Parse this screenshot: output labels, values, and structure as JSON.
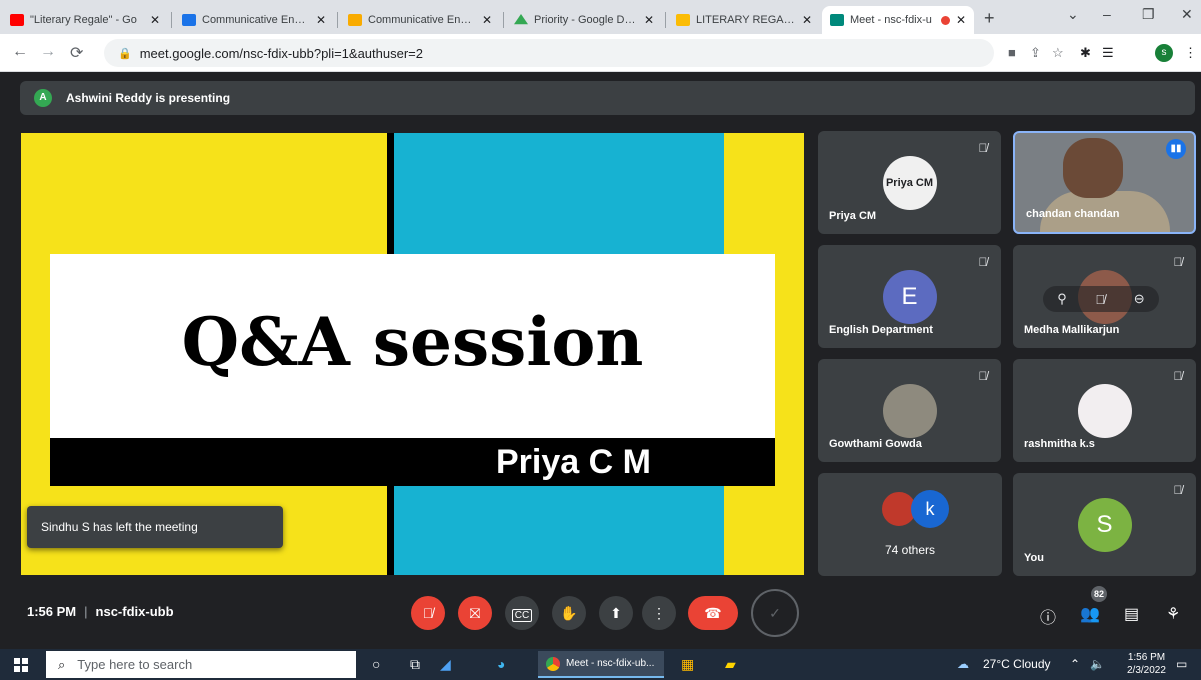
{
  "browser": {
    "tabs": [
      {
        "title": "\"Literary Regale\" - Go",
        "icon_color": "#ff0000",
        "icon": "youtube-icon",
        "active": false
      },
      {
        "title": "Communicative Englis",
        "icon_color": "#1a73e8",
        "icon": "classroom-icon",
        "active": false
      },
      {
        "title": "Communicative Englis",
        "icon_color": "#f9ab00",
        "icon": "classroom-icon",
        "active": false
      },
      {
        "title": "Priority - Google Drive",
        "icon_color": "#34a853",
        "icon": "drive-icon",
        "active": false
      },
      {
        "title": "LITERARY REGALE- TH",
        "icon_color": "#fbbc05",
        "icon": "slides-icon",
        "active": false
      },
      {
        "title": "Meet - nsc-fdix-u",
        "icon_color": "#00897b",
        "icon": "meet-icon",
        "active": true
      }
    ],
    "url": "meet.google.com/nsc-fdix-ubb?pli=1&authuser=2",
    "profile_initial": "s"
  },
  "meet": {
    "presenting_initial": "A",
    "presenting_text": "Ashwini Reddy is presenting",
    "slide": {
      "title": "Q&A session",
      "presenter": "Priya C M",
      "colors": {
        "yellow": "#f6e21a",
        "cyan": "#17b2d2"
      }
    },
    "toast": "Sindhu S has left the meeting",
    "participants": [
      {
        "name": "Priya CM",
        "avatar_label": "Priya CM",
        "muted": true
      },
      {
        "name": "chandan chandan",
        "video": true,
        "speaking": true
      },
      {
        "name": "English Department",
        "initial": "E",
        "color": "#5c6bc0",
        "muted": true
      },
      {
        "name": "Medha Mallikarjun",
        "muted": true
      },
      {
        "name": "Gowthami Gowda",
        "muted": true
      },
      {
        "name": "rashmitha k.s",
        "muted": true
      },
      {
        "name": "You",
        "initial": "S",
        "color": "#7cb342",
        "muted": true
      }
    ],
    "others": {
      "initial": "k",
      "label": "74 others"
    },
    "time": "1:56 PM",
    "meeting_code": "nsc-fdix-ubb",
    "people_count": "82"
  },
  "taskbar": {
    "search_placeholder": "Type here to search",
    "app_label": "Meet - nsc-fdix-ub...",
    "weather": "27°C  Cloudy",
    "time": "1:56 PM",
    "date": "2/3/2022"
  }
}
